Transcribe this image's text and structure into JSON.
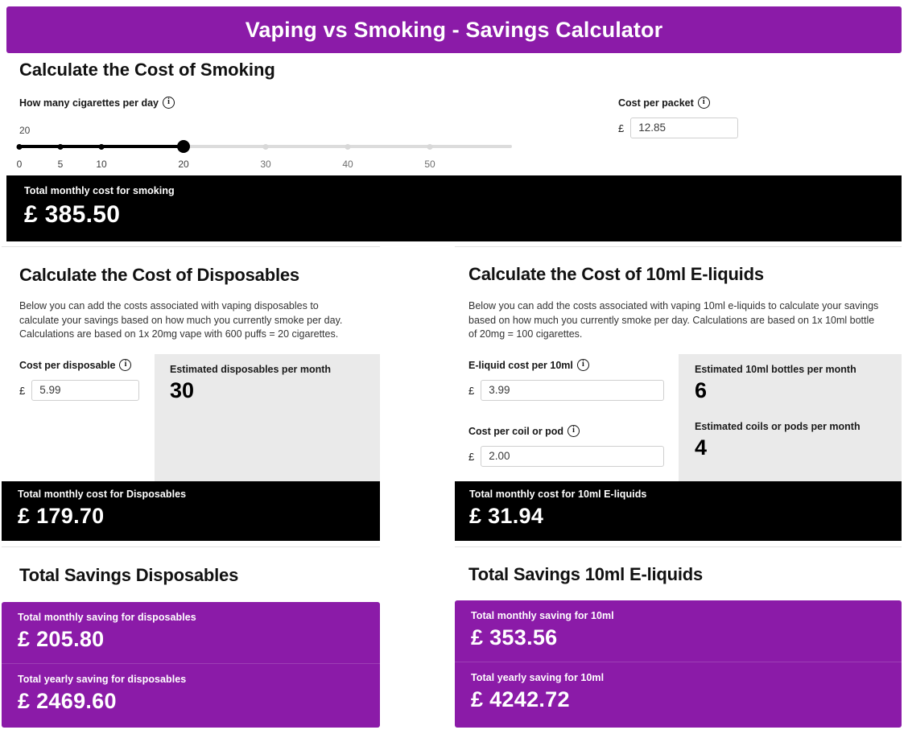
{
  "header": {
    "title": "Vaping vs Smoking - Savings Calculator",
    "accent_color": "#8B1BA8"
  },
  "smoking": {
    "heading": "Calculate the Cost of Smoking",
    "slider": {
      "label": "How many cigarettes per day",
      "info_icon": "info-circle-icon",
      "value": "20",
      "value_number": 20,
      "min": 0,
      "max": 60,
      "ticks": [
        "0",
        "5",
        "10",
        "20",
        "30",
        "40",
        "50"
      ],
      "tick_values": [
        0,
        5,
        10,
        20,
        30,
        40,
        50
      ]
    },
    "packet": {
      "label": "Cost per packet",
      "info_icon": "info-circle-icon",
      "currency": "£",
      "value": "12.85"
    },
    "total": {
      "label": "Total monthly cost for smoking",
      "amount": "£ 385.50"
    }
  },
  "disposables": {
    "heading": "Calculate the Cost of Disposables",
    "description": "Below you can add the costs associated with vaping disposables to calculate your savings based on how much you currently smoke per day. Calculations are based on 1x 20mg vape with 600 puffs = 20 cigarettes.",
    "cost_field": {
      "label": "Cost per disposable",
      "info_icon": "info-circle-icon",
      "currency": "£",
      "value": "5.99"
    },
    "estimate": {
      "label": "Estimated disposables per month",
      "value": "30"
    },
    "total": {
      "label": "Total monthly cost for Disposables",
      "amount": "£ 179.70"
    },
    "savings": {
      "heading": "Total Savings Disposables",
      "monthly_label": "Total monthly saving for disposables",
      "monthly_amount": "£ 205.80",
      "yearly_label": "Total yearly saving for disposables",
      "yearly_amount": "£ 2469.60"
    }
  },
  "eliquids": {
    "heading": "Calculate the Cost of 10ml E-liquids",
    "description": "Below you can add the costs associated with vaping 10ml e-liquids to calculate your savings based on how much you currently smoke per day. Calculations are based on 1x 10ml bottle of 20mg = 100 cigarettes.",
    "cost_field": {
      "label": "E-liquid cost per 10ml",
      "info_icon": "info-circle-icon",
      "currency": "£",
      "value": "3.99"
    },
    "coil_field": {
      "label": "Cost per coil or pod",
      "info_icon": "info-circle-icon",
      "currency": "£",
      "value": "2.00"
    },
    "estimate_bottles": {
      "label": "Estimated 10ml bottles per month",
      "value": "6"
    },
    "estimate_coils": {
      "label": "Estimated coils or pods per month",
      "value": "4"
    },
    "total": {
      "label": "Total monthly cost for 10ml E-liquids",
      "amount": "£ 31.94"
    },
    "savings": {
      "heading": "Total Savings 10ml E-liquids",
      "monthly_label": "Total monthly saving for 10ml",
      "monthly_amount": "£ 353.56",
      "yearly_label": "Total yearly saving for 10ml",
      "yearly_amount": "£ 4242.72"
    }
  }
}
